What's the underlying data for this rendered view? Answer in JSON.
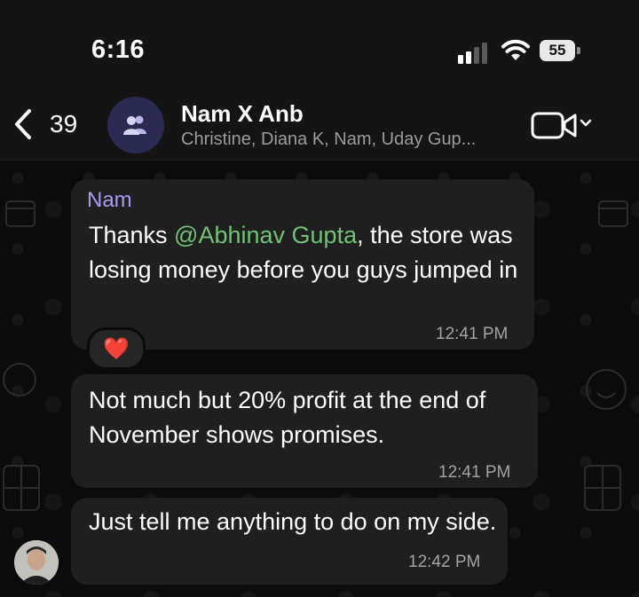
{
  "status_bar": {
    "time": "6:16",
    "battery_level": "55",
    "icons": [
      "signal-icon",
      "wifi-icon",
      "battery-icon"
    ]
  },
  "header": {
    "back_count": "39",
    "title": "Nam X Anb",
    "subtitle": "Christine, Diana K, Nam, Uday Gup...",
    "icons": [
      "chevron-left-icon",
      "group-icon",
      "video-call-icon",
      "chevron-down-icon"
    ]
  },
  "messages": [
    {
      "sender": "Nam",
      "text_before": "Thanks ",
      "mention": "@Abhinav Gupta",
      "text_after": ", the store was losing money before you guys jumped in",
      "time": "12:41 PM",
      "reaction": "❤️"
    },
    {
      "text": "Not much but 20% profit at the end of November shows promises.",
      "time": "12:41 PM"
    },
    {
      "text": "Just tell me anything to do on my side.",
      "time": "12:42 PM"
    }
  ],
  "colors": {
    "background": "#0b0b0b",
    "bubble": "#1f1f1f",
    "sender_name": "#a99af5",
    "mention": "#6fc374",
    "group_avatar": "#2b2a52"
  }
}
